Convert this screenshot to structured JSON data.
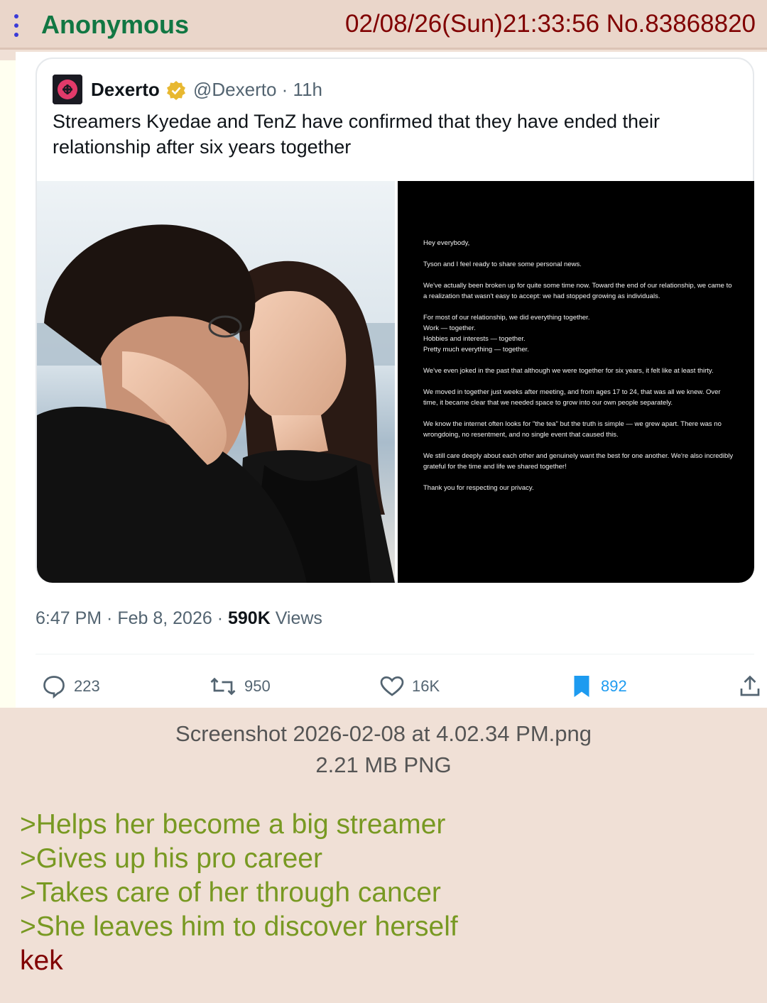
{
  "post": {
    "name": "Anonymous",
    "date_number": "02/08/26(Sun)21:33:56 No.83868820"
  },
  "tweet": {
    "author": "Dexerto",
    "handle_time": "@Dexerto · 11h",
    "text": "Streamers Kyedae and TenZ have confirmed that they have ended their relationship after six years together",
    "letter": [
      "Hey everybody,",
      "Tyson and I feel ready to share some personal news.",
      "We've actually been broken up for quite some time now. Toward the end of our relationship, we came to a realization that wasn't easy to accept: we had stopped growing as individuals.",
      "For most of our relationship, we did everything together.\nWork — together.\nHobbies and interests — together.\nPretty much everything — together.",
      "We've even joked in the past that although we were together for six years, it felt like at least thirty.",
      "We moved in together just weeks after meeting, and from ages 17 to 24, that was all we knew. Over time, it became clear that we needed space to grow into our own people separately.",
      "We know the internet often looks for \"the tea\" but the truth is simple — we grew apart. There was no wrongdoing, no resentment, and no single event that caused this.",
      "We still care deeply about each other and genuinely want the best for one another. We're also incredibly grateful for the time and life we shared together!",
      "Thank you for respecting our privacy."
    ],
    "time_prefix": "6:47 PM · Feb 8, 2026 · ",
    "views_count": "590K",
    "views_label": " Views",
    "replies": "223",
    "reposts": "950",
    "likes": "16K",
    "bookmarks": "892",
    "colors": {
      "verified": "#e8b830",
      "bookmark": "#1d9bf0"
    }
  },
  "attachment": {
    "filename": "Screenshot 2026-02-08 at 4.02.34 PM.png",
    "meta": "2.21 MB PNG"
  },
  "comment": {
    "lines": [
      ">Helps her become a big streamer",
      ">Gives up his pro career",
      ">Takes care of her through cancer",
      ">She leaves him to discover herself"
    ],
    "last": "kek"
  },
  "colors": {
    "greentext": "#789922",
    "name": "#117743",
    "meta": "#800000"
  }
}
